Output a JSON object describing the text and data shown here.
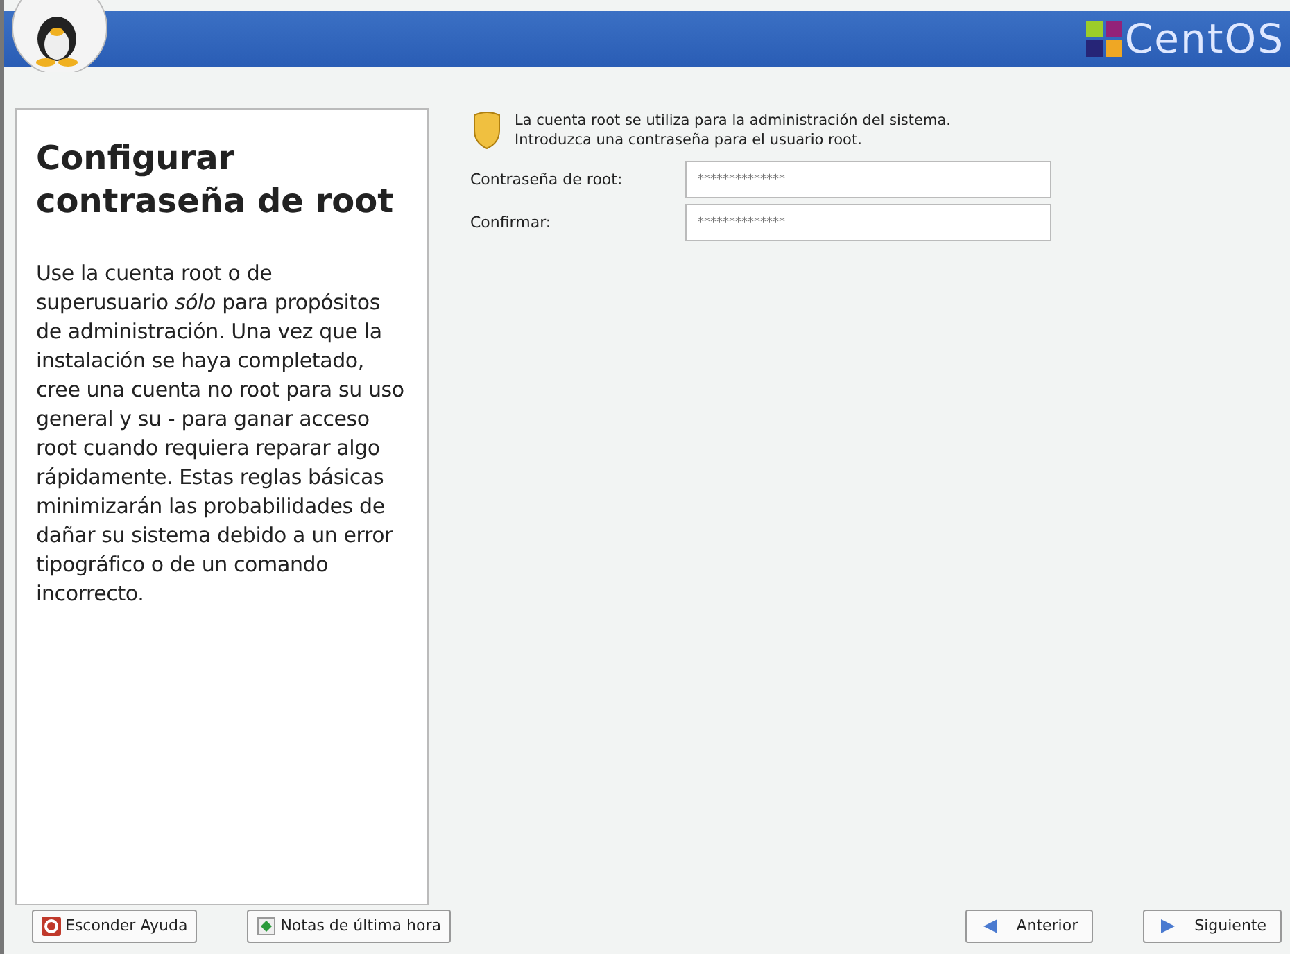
{
  "header": {
    "logo_text": "CentOS"
  },
  "help": {
    "title": "Configurar contraseña de root",
    "text": "Use la cuenta root o de superusuario *sólo* para propósitos de administración. Una vez que la instalación se haya completado, cree una cuenta no root para su uso general y su  - para ganar acceso root cuando requiera reparar algo rápidamente. Estas reglas básicas minimizarán las probabilidades de dañar su sistema debido a un error tipográfico o de un comando incorrecto."
  },
  "intro": [
    "La cuenta root se utiliza para la administración del sistema.",
    "Introduzca una contraseña para el usuario root."
  ],
  "fields": [
    {
      "label": "Contraseña de root:",
      "value": "**************"
    },
    {
      "label": "Confirmar:",
      "value": "**************"
    }
  ],
  "left_buttons": [
    {
      "label": "Esconder Ayuda",
      "kind": "help"
    },
    {
      "label": "Notas de última hora",
      "kind": "notes"
    }
  ],
  "right_buttons": [
    {
      "label": "Anterior",
      "kind": "back"
    },
    {
      "label": "Siguiente",
      "kind": "next"
    }
  ]
}
